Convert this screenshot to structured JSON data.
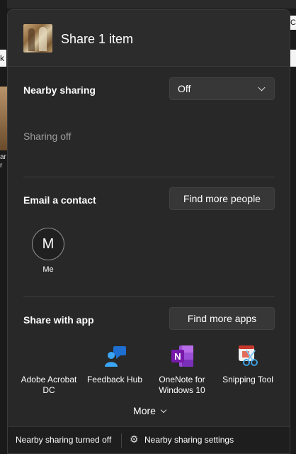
{
  "share": {
    "title": "Share 1 item",
    "nearby": {
      "label": "Nearby sharing",
      "value": "Off",
      "status": "Sharing off"
    },
    "email": {
      "label": "Email a contact",
      "find_button": "Find more people",
      "contacts": [
        {
          "initial": "M",
          "name": "Me"
        }
      ]
    },
    "apps": {
      "label": "Share with app",
      "find_button": "Find more apps",
      "items": [
        {
          "name": "Adobe Acrobat DC",
          "icon": "adobe-acrobat-icon"
        },
        {
          "name": "Feedback Hub",
          "icon": "feedback-hub-icon"
        },
        {
          "name": "OneNote for Windows 10",
          "icon": "onenote-icon"
        },
        {
          "name": "Snipping Tool",
          "icon": "snipping-tool-icon"
        }
      ],
      "more_label": "More"
    },
    "footer": {
      "status": "Nearby sharing turned off",
      "settings": "Nearby sharing settings"
    }
  },
  "background": {
    "left_field_char": "k",
    "right_field_char": "C",
    "thumb_caption": "ar r"
  }
}
